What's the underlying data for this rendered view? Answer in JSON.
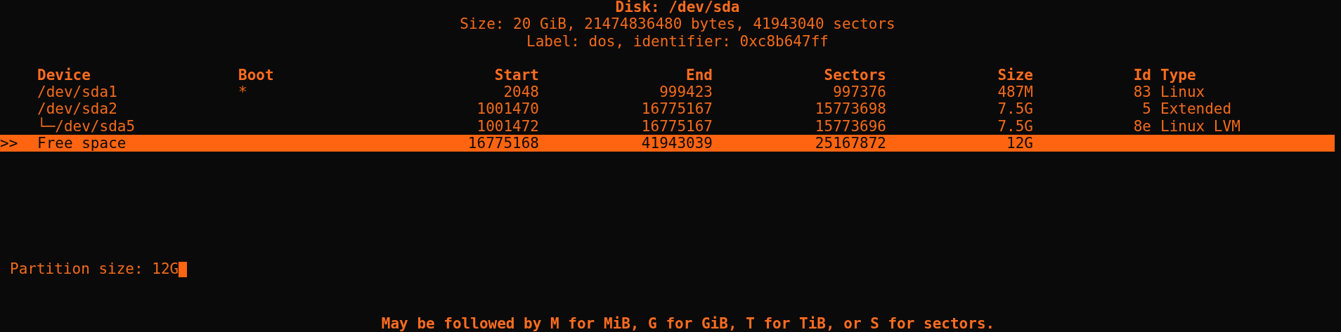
{
  "disk": {
    "title": "Disk: /dev/sda",
    "size_line": "Size: 20 GiB, 21474836480 bytes, 41943040 sectors",
    "label_line": "Label: dos, identifier: 0xc8b647ff"
  },
  "table": {
    "pointer": ">>",
    "columns": [
      "Device",
      "Boot",
      "Start",
      "End",
      "Sectors",
      "Size",
      "Id",
      "Type"
    ],
    "rows": [
      {
        "selected": false,
        "device": "/dev/sda1",
        "boot": "*",
        "start": "2048",
        "end": "999423",
        "sectors": "997376",
        "size": "487M",
        "id": "83",
        "type": "Linux"
      },
      {
        "selected": false,
        "device": "/dev/sda2",
        "start": "1001470",
        "end": "16775167",
        "sectors": "15773698",
        "size": "7.5G",
        "id": "5",
        "type": "Extended"
      },
      {
        "selected": false,
        "device": "└─/dev/sda5",
        "start": "1001472",
        "end": "16775167",
        "sectors": "15773696",
        "size": "7.5G",
        "id": "8e",
        "type": "Linux LVM"
      },
      {
        "selected": true,
        "device": "Free space",
        "start": "16775168",
        "end": "41943039",
        "sectors": "25167872",
        "size": "12G"
      }
    ]
  },
  "prompt": {
    "label": "Partition size:",
    "value": "12G"
  },
  "hint": "May be followed by M for MiB, G for GiB, T for TiB, or S for sectors."
}
